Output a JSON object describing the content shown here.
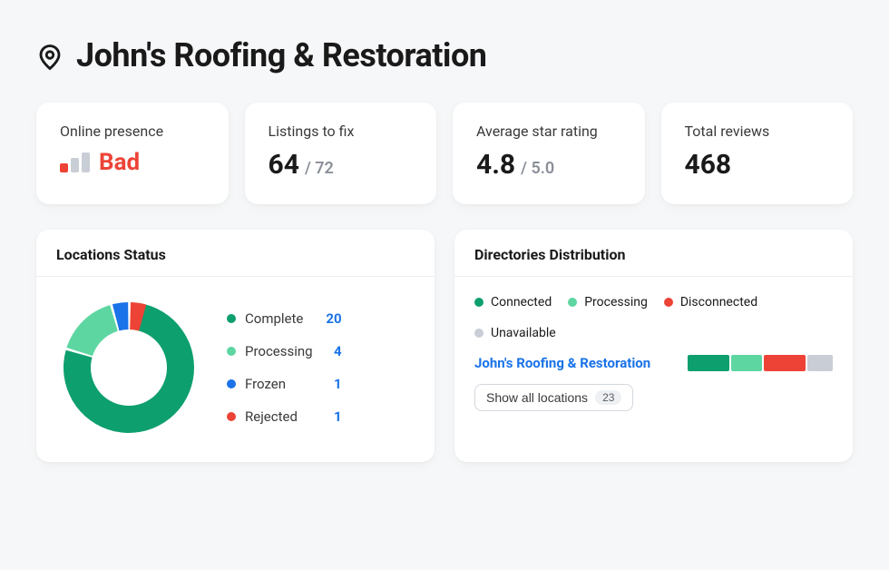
{
  "header": {
    "title": "John's Roofing & Restoration"
  },
  "stats": {
    "presence": {
      "label": "Online presence",
      "value": "Bad"
    },
    "listings": {
      "label": "Listings to fix",
      "value": "64",
      "sub": "/ 72"
    },
    "rating": {
      "label": "Average star rating",
      "value": "4.8",
      "sub": "/ 5.0"
    },
    "reviews": {
      "label": "Total reviews",
      "value": "468"
    }
  },
  "locations": {
    "title": "Locations Status",
    "items": [
      {
        "label": "Complete",
        "value": 20,
        "color": "#0e9f6e"
      },
      {
        "label": "Processing",
        "value": 4,
        "color": "#5dd6a2"
      },
      {
        "label": "Frozen",
        "value": 1,
        "color": "#1a73e8"
      },
      {
        "label": "Rejected",
        "value": 1,
        "color": "#ed4337"
      }
    ]
  },
  "chart_data": {
    "type": "pie",
    "title": "Locations Status",
    "categories": [
      "Complete",
      "Processing",
      "Frozen",
      "Rejected"
    ],
    "values": [
      20,
      4,
      1,
      1
    ],
    "colors": [
      "#0e9f6e",
      "#5dd6a2",
      "#1a73e8",
      "#ed4337"
    ]
  },
  "directories": {
    "title": "Directories Distribution",
    "legend": [
      {
        "label": "Connected",
        "color": "#0e9f6e"
      },
      {
        "label": "Processing",
        "color": "#5dd6a2"
      },
      {
        "label": "Disconnected",
        "color": "#ed4337"
      },
      {
        "label": "Unavailable",
        "color": "#c9ced6"
      }
    ],
    "row": {
      "name": "John's Roofing & Restoration",
      "segments": [
        {
          "color": "#0e9f6e",
          "flex": 30
        },
        {
          "color": "#5dd6a2",
          "flex": 22
        },
        {
          "color": "#ed4337",
          "flex": 30
        },
        {
          "color": "#c9ced6",
          "flex": 18
        }
      ]
    },
    "button": {
      "label": "Show all locations",
      "count": "23"
    }
  }
}
